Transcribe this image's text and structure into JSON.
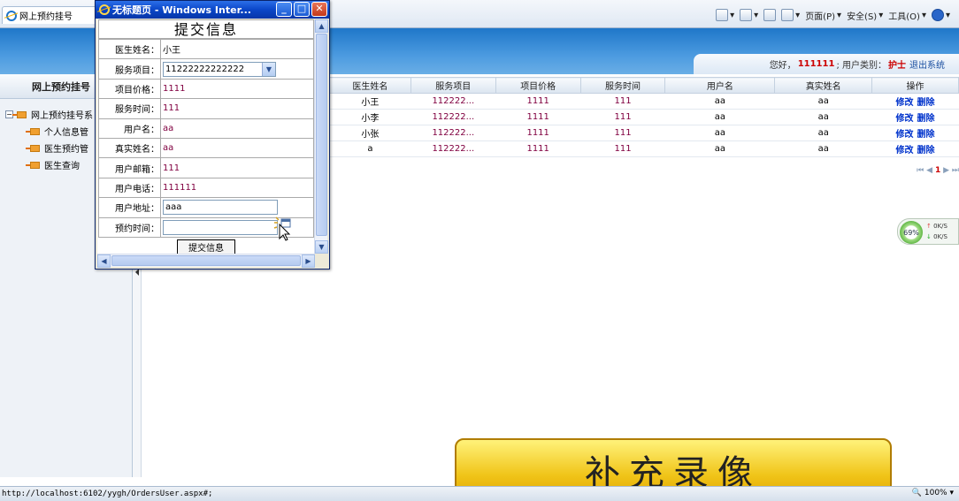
{
  "browser": {
    "tab_title": "网上预约挂号",
    "commands": [
      "页面(P)",
      "安全(S)",
      "工具(O)"
    ],
    "status_url": "http://localhost:6102/yygh/OrdersUser.aspx#;",
    "zoom": "100%"
  },
  "header": {
    "greeting": "您好，",
    "username": "111111",
    "user_type_label": "; 用户类别：",
    "user_type": "护士",
    "logout": "退出系统"
  },
  "sidebar": {
    "title": "网上预约挂号",
    "root": "网上预约挂号系",
    "items": [
      {
        "label": "个人信息管"
      },
      {
        "label": "医生预约管"
      },
      {
        "label": "医生查询"
      }
    ]
  },
  "grid": {
    "columns": [
      "医生姓名",
      "服务项目",
      "项目价格",
      "服务时间",
      "用户名",
      "真实姓名",
      "操作"
    ],
    "rows": [
      [
        "小王",
        "112222...",
        "1111",
        "111",
        "aa",
        "aa"
      ],
      [
        "小李",
        "112222...",
        "1111",
        "111",
        "aa",
        "aa"
      ],
      [
        "小张",
        "112222...",
        "1111",
        "111",
        "aa",
        "aa"
      ],
      [
        "a",
        "112222...",
        "1111",
        "111",
        "aa",
        "aa"
      ]
    ],
    "edit_label": "修改",
    "delete_label": "删除",
    "pager": {
      "first": "⏮",
      "prev": "◀",
      "current": "1",
      "next": "▶",
      "last": "⏭"
    }
  },
  "net_widget": {
    "percent": "69%",
    "up": "0K/S",
    "down": "0K/S"
  },
  "watermark": "补充录像",
  "popup": {
    "window_title": "无标题页 - Windows Inter...",
    "form_title": "提交信息",
    "fields": [
      {
        "label": "医生姓名：",
        "value": "小王"
      },
      {
        "label": "服务项目：",
        "value": "11222222222222"
      },
      {
        "label": "项目价格：",
        "value": "1111"
      },
      {
        "label": "服务时间：",
        "value": "111"
      },
      {
        "label": "用户名：",
        "value": "aa"
      },
      {
        "label": "真实姓名：",
        "value": "aa"
      },
      {
        "label": "用户邮箱：",
        "value": "111"
      },
      {
        "label": "用户电话：",
        "value": "111111"
      },
      {
        "label": "用户地址：",
        "value": "aaa"
      },
      {
        "label": "预约时间：",
        "value": ""
      }
    ],
    "submit_label": "提交信息"
  }
}
